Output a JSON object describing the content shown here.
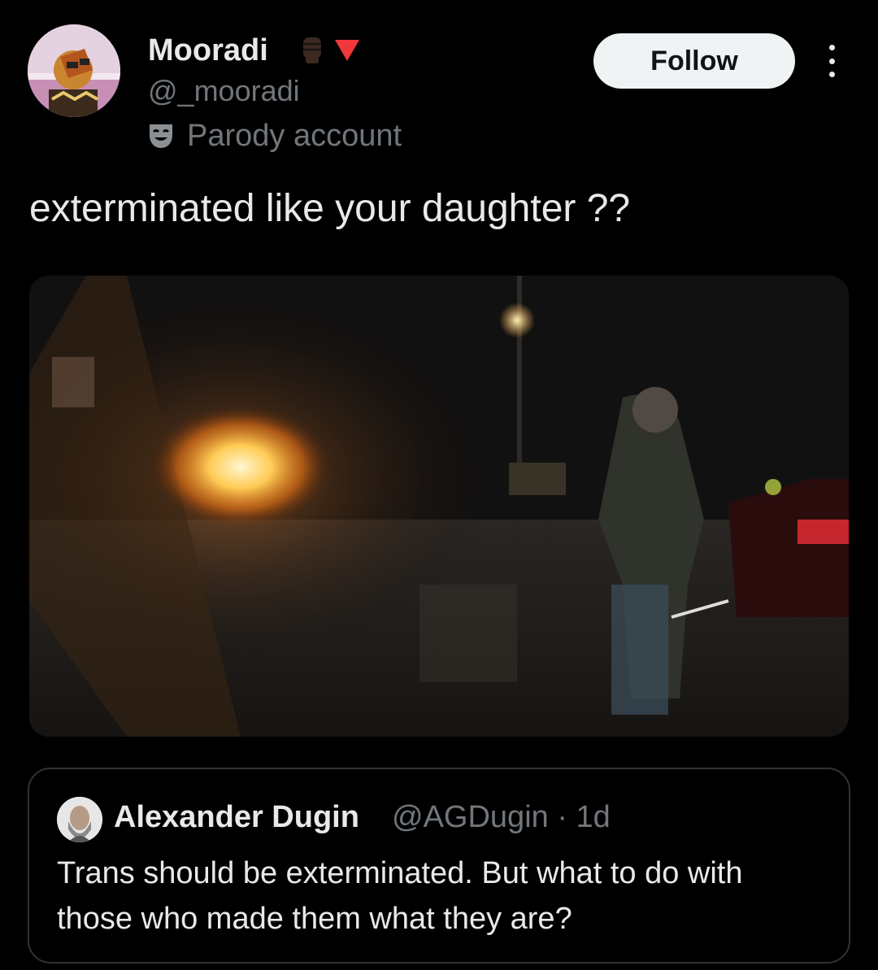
{
  "author": {
    "display_name": "Mooradi",
    "handle": "@_mooradi",
    "emoji_icon": "raised-fist-emoji",
    "triangle_icon": "red-triangle-down-emoji",
    "label": "Parody account",
    "label_icon": "theater-mask-icon"
  },
  "actions": {
    "follow_label": "Follow",
    "more_icon": "more-options-icon"
  },
  "tweet": {
    "text": "exterminated like your daughter ??"
  },
  "quoted": {
    "display_name": "Alexander Dugin",
    "handle_time": "@AGDugin · 1d",
    "text": "Trans should be exterminated. But what to do with those who made them what they are?"
  },
  "colors": {
    "background": "#000000",
    "text": "#e7e9ea",
    "muted": "#71767b",
    "border": "#2f3336",
    "follow_bg": "#eff3f4"
  }
}
